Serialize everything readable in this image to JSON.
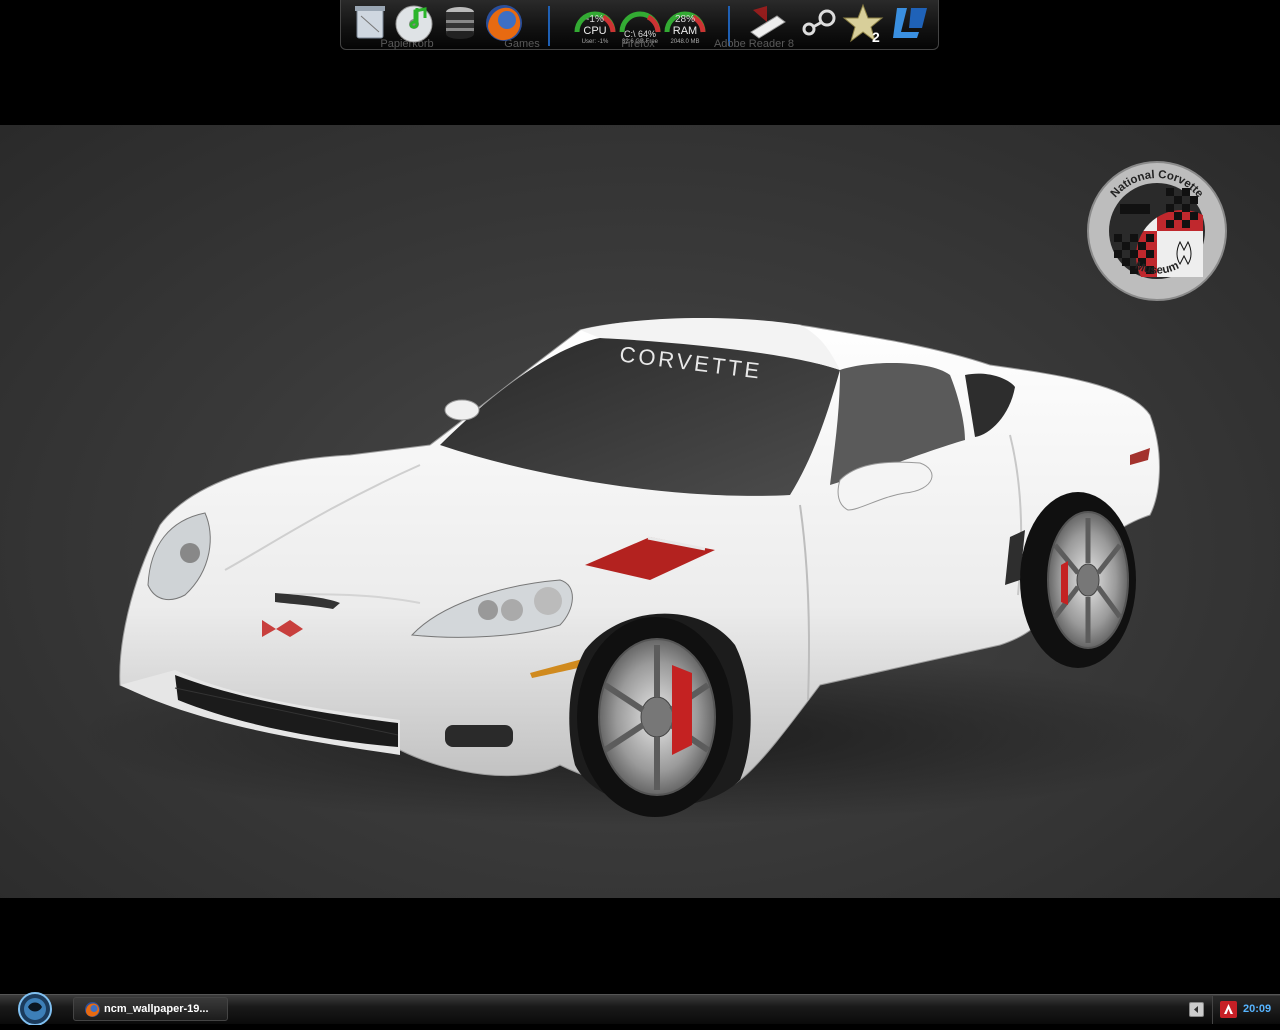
{
  "dock": {
    "labels": {
      "trash": "Papierkorb",
      "games": "Games",
      "firefox": "Firefox",
      "reader": "Adobe Reader 8"
    },
    "gauges": {
      "cpu": {
        "value": "-1%",
        "name": "CPU",
        "sub": "User: -1%"
      },
      "disk": {
        "value": "C:\\ 64%",
        "name": "",
        "sub": "32.6 GB Free"
      },
      "ram": {
        "value": "28%",
        "name": "RAM",
        "sub": "2048.0 MB"
      }
    },
    "icons": [
      "trash-icon",
      "music-disc-icon",
      "drive-stack-icon",
      "firefox-icon",
      "adobe-reader-icon",
      "steam-icon",
      "star-2-icon",
      "logo-icon"
    ]
  },
  "wallpaper": {
    "badge_top": "National Corvette",
    "badge_bottom": "Museum",
    "windshield_text": "CORVETTE"
  },
  "taskbar": {
    "task_label": "ncm_wallpaper-19...",
    "clock": "20:09"
  },
  "colors": {
    "accent": "#56b4ff",
    "badge_red": "#c0282d",
    "stripe_red": "#b3221f"
  }
}
